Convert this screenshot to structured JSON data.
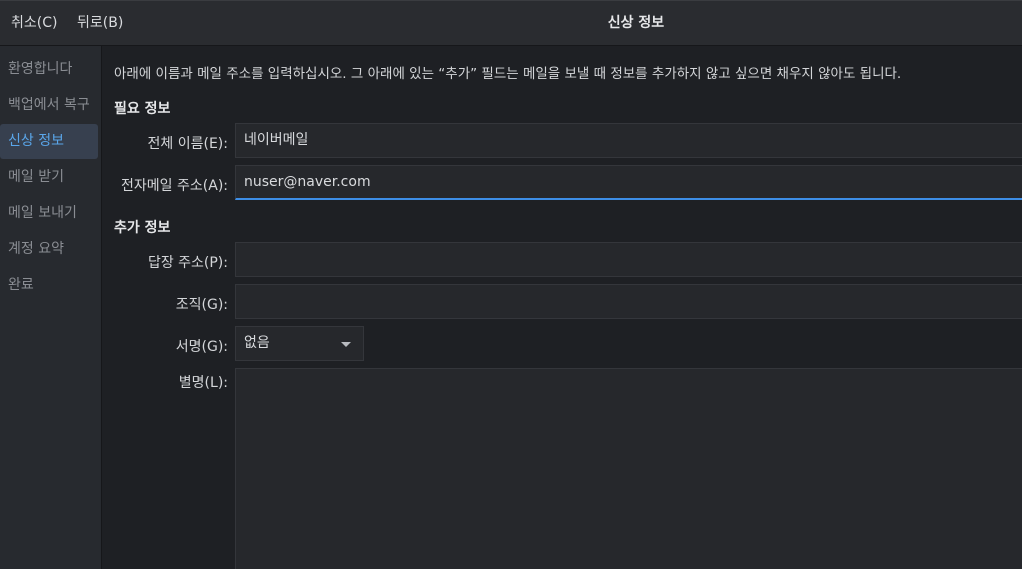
{
  "header": {
    "cancel_label": "취소(C)",
    "back_label": "뒤로(B)",
    "title": "신상 정보"
  },
  "sidebar": {
    "items": [
      {
        "label": "환영합니다",
        "active": false
      },
      {
        "label": "백업에서 복구",
        "active": false
      },
      {
        "label": "신상 정보",
        "active": true
      },
      {
        "label": "메일 받기",
        "active": false
      },
      {
        "label": "메일 보내기",
        "active": false
      },
      {
        "label": "계정 요약",
        "active": false
      },
      {
        "label": "완료",
        "active": false
      }
    ]
  },
  "main": {
    "intro": "아래에 이름과 메일 주소를 입력하십시오. 그 아래에 있는 “추가” 필드는 메일을 보낼 때 정보를 추가하지 않고 싶으면 채우지 않아도 됩니다.",
    "required_section": "필요 정보",
    "optional_section": "추가 정보",
    "fullname": {
      "label": "전체 이름(E):",
      "value": "네이버메일"
    },
    "email": {
      "label": "전자메일 주소(A):",
      "value": "nuser@naver.com"
    },
    "reply_to": {
      "label": "답장 주소(P):",
      "value": ""
    },
    "organization": {
      "label": "조직(G):",
      "value": ""
    },
    "signature": {
      "label": "서명(G):",
      "value": "없음"
    },
    "aliases": {
      "label": "별명(L):",
      "value": ""
    }
  },
  "colors": {
    "accent": "#3d8ee6",
    "sidebar_active_bg": "#37404f",
    "sidebar_active_text": "#5aa6ea"
  }
}
